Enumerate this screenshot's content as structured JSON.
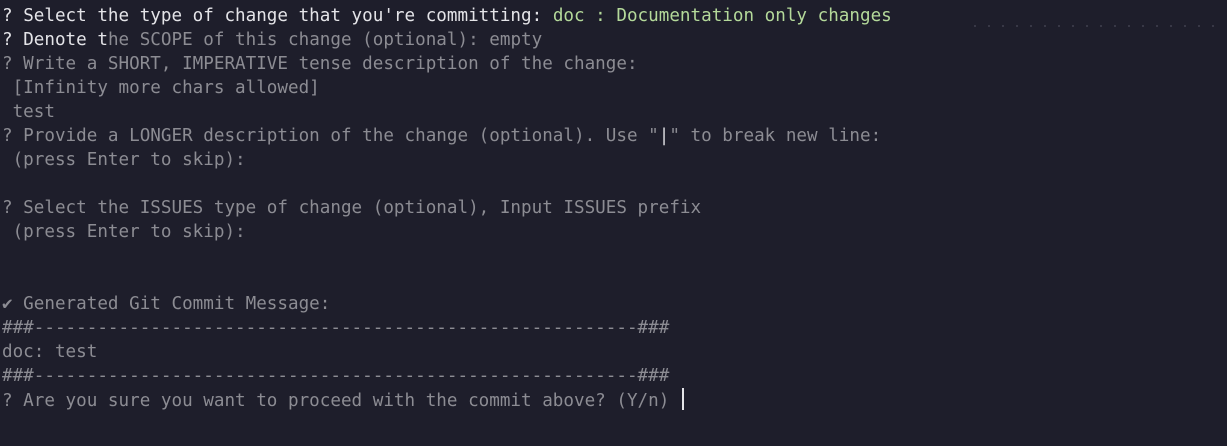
{
  "terminal": {
    "q_type_prefix": "? ",
    "q_type_text": "Select the type of change that you're committing: ",
    "q_type_answer": "doc : Documentation only changes",
    "q_scope_prefix": "? ",
    "q_scope_bright": "Denote t",
    "q_scope_dim": "he SCOPE of this change (optional): empty",
    "q_short": "? Write a SHORT, IMPERATIVE tense description of the change:",
    "q_short_hint": " [Infinity more chars allowed]",
    "q_short_answer": " test",
    "q_long_before": "? Provide a LONGER description of the change (optional). Use \"",
    "q_long_bar": "|",
    "q_long_after": "\" to break new line:",
    "q_long_hint": " (press Enter to skip):",
    "q_issues": "? Select the ISSUES type of change (optional), Input ISSUES prefix",
    "q_issues_hint": " (press Enter to skip):",
    "generated_title": "✔ Generated Git Commit Message:",
    "separator": "###---------------------------------------------------------###",
    "commit_message": "doc: test",
    "confirm_question": "? Are you sure you want to proceed with the commit above? (Y/n) "
  }
}
